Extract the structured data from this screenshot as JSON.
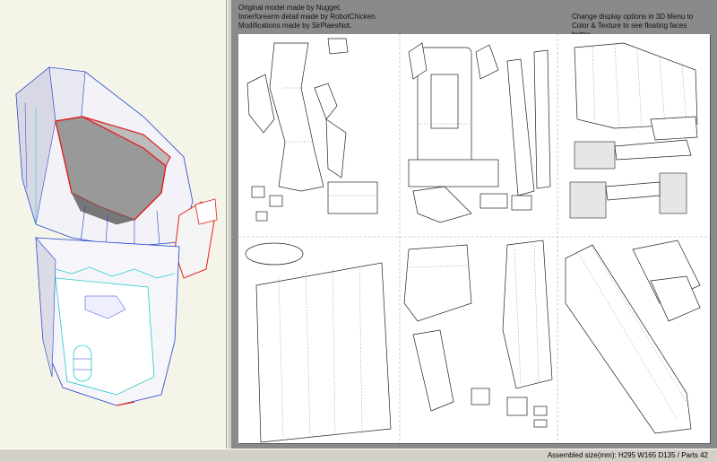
{
  "credits": {
    "line1": "Original model made by Nugget.",
    "line2": "Innerforearm detail made by RobotChicken.",
    "line3": "Modifications made by SirPlaesNot."
  },
  "hint": {
    "line1": "Change display options in 3D Menu to",
    "line2": "Color & Texture to see floating faces better."
  },
  "status": {
    "text": "Assembled size(mm): H295 W165 D135 / Parts 42"
  },
  "colors": {
    "model_background": "#f4f4e8",
    "model_face": "#ffffff",
    "model_edge": "#2244cc",
    "model_selected_edge": "#e02020",
    "model_cyan_edge": "#22cccc",
    "sheet_background": "#8a8a8a"
  }
}
